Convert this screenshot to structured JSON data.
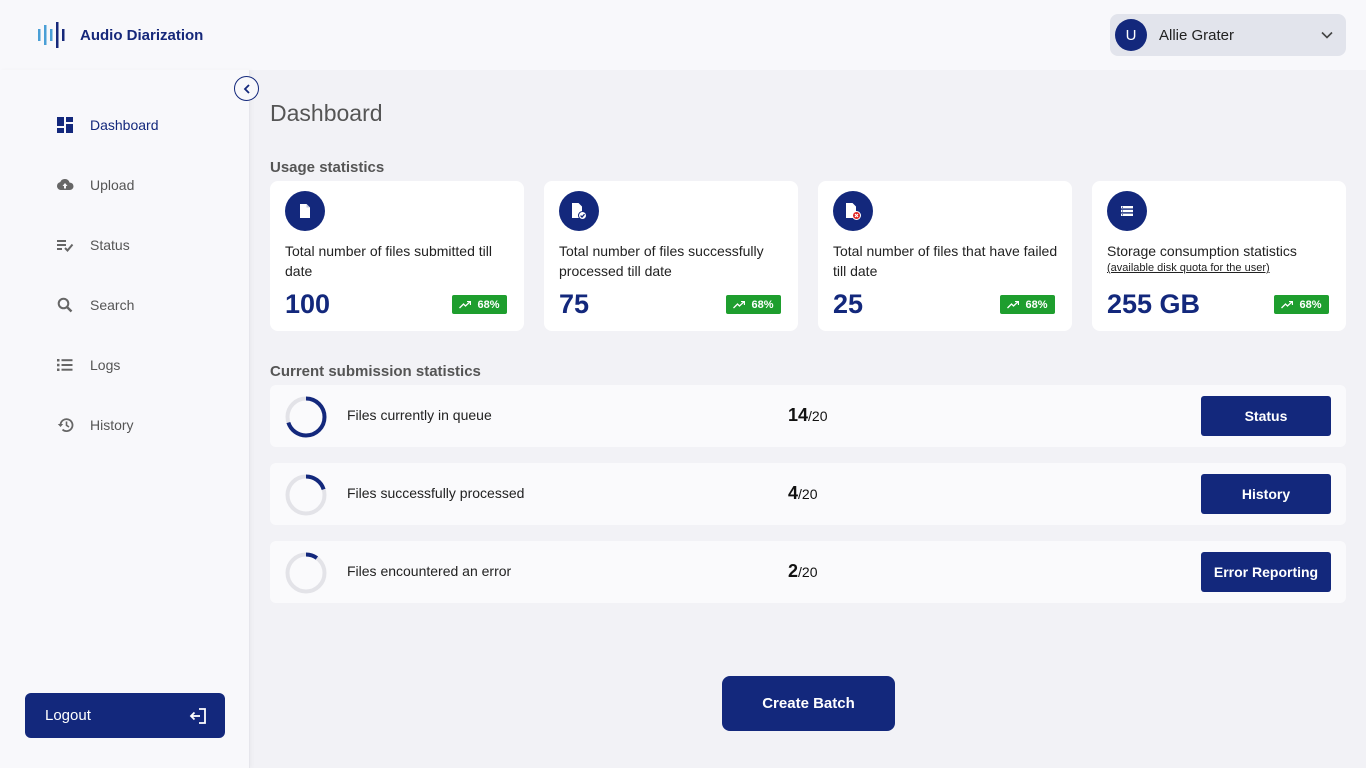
{
  "app": {
    "name": "Audio Diarization"
  },
  "user": {
    "initial": "U",
    "name": "Allie Grater"
  },
  "sidebar": {
    "items": [
      {
        "label": "Dashboard",
        "icon": "dashboard-icon",
        "active": true
      },
      {
        "label": "Upload",
        "icon": "cloud-upload-icon"
      },
      {
        "label": "Status",
        "icon": "status-list-icon"
      },
      {
        "label": "Search",
        "icon": "search-icon"
      },
      {
        "label": "Logs",
        "icon": "list-icon"
      },
      {
        "label": "History",
        "icon": "history-icon"
      }
    ],
    "logout_label": "Logout"
  },
  "page": {
    "title": "Dashboard"
  },
  "usage": {
    "title": "Usage statistics",
    "cards": [
      {
        "desc": "Total number of files submitted till date",
        "sub": "",
        "value": "100",
        "badge": "68%",
        "icon": "file-icon"
      },
      {
        "desc": "Total number of files successfully processed till date",
        "sub": "",
        "value": "75",
        "badge": "68%",
        "icon": "file-check-icon"
      },
      {
        "desc": "Total number of files that have failed till date",
        "sub": "",
        "value": "25",
        "badge": "68%",
        "icon": "file-error-icon"
      },
      {
        "desc": "Storage consumption statistics",
        "sub": "(available disk quota for the user)",
        "value": "255 GB",
        "badge": "68%",
        "icon": "storage-icon"
      }
    ]
  },
  "submission": {
    "title": "Current submission statistics",
    "rows": [
      {
        "label": "Files currently in queue",
        "count": "14",
        "total": "/20",
        "fraction": 0.7,
        "button": "Status"
      },
      {
        "label": "Files successfully processed",
        "count": "4",
        "total": "/20",
        "fraction": 0.2,
        "button": "History"
      },
      {
        "label": "Files encountered an error",
        "count": "2",
        "total": "/20",
        "fraction": 0.1,
        "button": "Error Reporting"
      }
    ]
  },
  "actions": {
    "create_batch": "Create Batch"
  },
  "colors": {
    "primary": "#13287c",
    "badge": "#1e9e2e",
    "ring_track": "#e3e3e8"
  }
}
